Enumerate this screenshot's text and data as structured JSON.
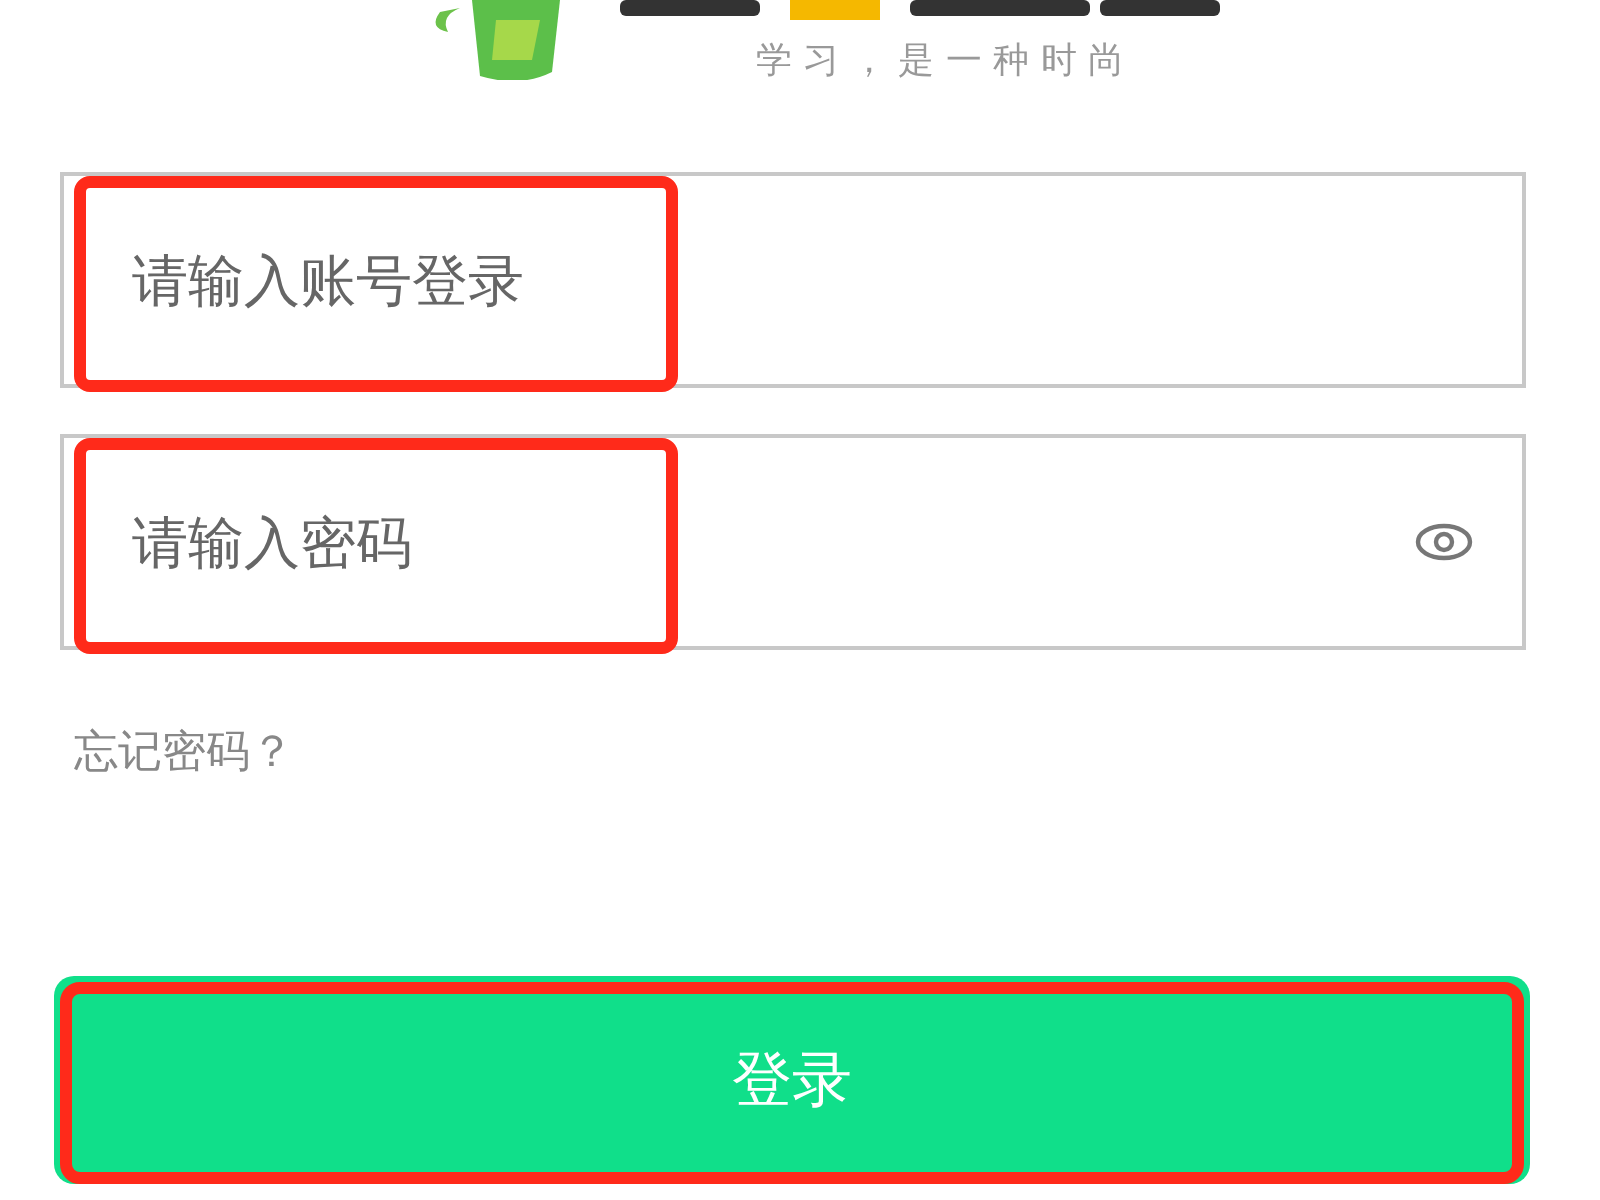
{
  "logo": {
    "slogan": "学 习 ， 是 一 种 时 尚"
  },
  "fields": [
    {
      "kind": "text",
      "placeholder": "请输入账号登录",
      "highlighted": true
    },
    {
      "kind": "password",
      "placeholder": "请输入密码",
      "highlighted": true
    }
  ],
  "forgot_link": "忘记密码？",
  "login_button": {
    "label": "登录",
    "highlighted": true
  }
}
